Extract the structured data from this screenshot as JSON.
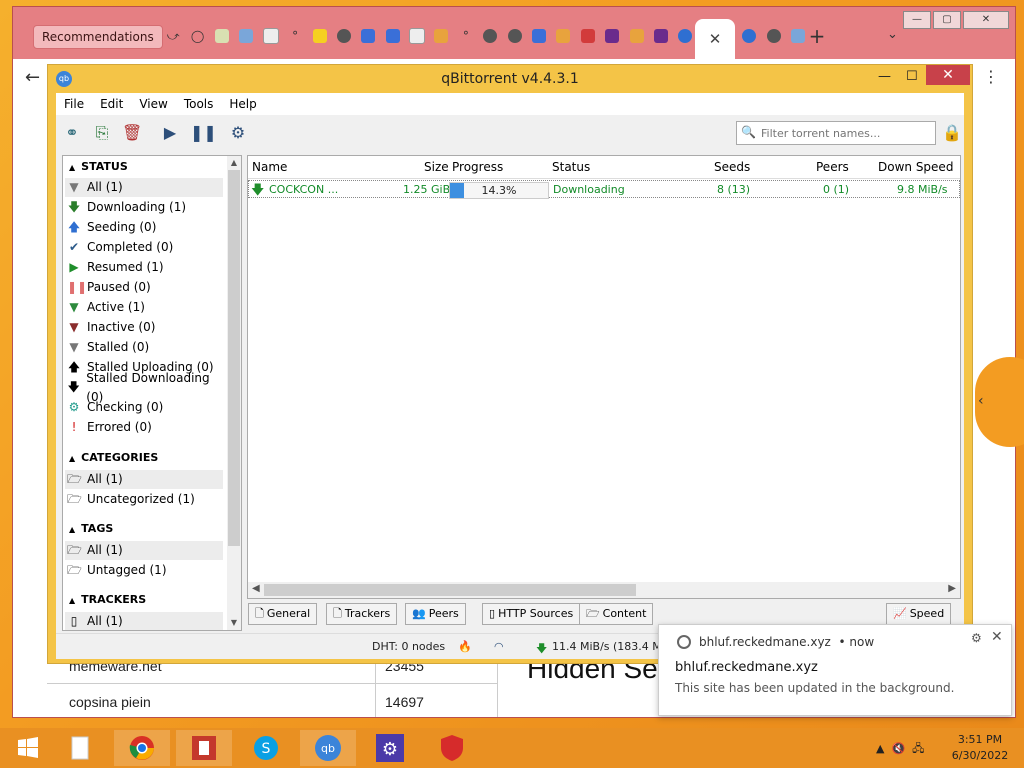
{
  "browser": {
    "recommendations_label": "Recommendations",
    "new_tab_label": "+",
    "active_tab_close": "✕",
    "tab_dropdown": "⌄",
    "back_arrow": "←",
    "menu_kebab": "⋮",
    "window_min": "—",
    "window_max": "▢",
    "window_close": "✕"
  },
  "webpage": {
    "rows": [
      {
        "name": "memeware.net",
        "value": "23455"
      },
      {
        "name": "copsina piein",
        "value": "14697"
      }
    ],
    "heading": "Hidden Se",
    "side_arrow": "‹"
  },
  "qbittorrent": {
    "title": "qBittorrent v4.4.3.1",
    "logo_text": "qb",
    "min": "—",
    "max": "☐",
    "close": "✕",
    "menu": [
      "File",
      "Edit",
      "View",
      "Tools",
      "Help"
    ],
    "search_placeholder": "Filter torrent names...",
    "sidebar": {
      "status_header": "STATUS",
      "status_items": [
        {
          "label": "All (1)",
          "icon": "filter-icon",
          "color": "#777777"
        },
        {
          "label": "Downloading (1)",
          "icon": "download-arrow-icon",
          "color": "#2a7d2a"
        },
        {
          "label": "Seeding (0)",
          "icon": "upload-arrow-icon",
          "color": "#2f6fd1"
        },
        {
          "label": "Completed (0)",
          "icon": "checkmark-icon",
          "color": "#2d5b8a"
        },
        {
          "label": "Resumed (1)",
          "icon": "play-icon",
          "color": "#1f8e2b"
        },
        {
          "label": "Paused (0)",
          "icon": "pause-icon",
          "color": "#e07070"
        },
        {
          "label": "Active (1)",
          "icon": "filter-icon",
          "color": "#2d8a3d"
        },
        {
          "label": "Inactive (0)",
          "icon": "filter-icon",
          "color": "#8a2d2d"
        },
        {
          "label": "Stalled (0)",
          "icon": "filter-icon",
          "color": "#777777"
        },
        {
          "label": "Stalled Uploading (0)",
          "icon": "upload-arrow-icon",
          "color": "#000000"
        },
        {
          "label": "Stalled Downloading (0)",
          "icon": "download-arrow-icon",
          "color": "#000000"
        },
        {
          "label": "Checking (0)",
          "icon": "gear-icon",
          "color": "#1e9a8a"
        },
        {
          "label": "Errored (0)",
          "icon": "exclamation-icon",
          "color": "#d11a1a"
        }
      ],
      "categories_header": "CATEGORIES",
      "category_items": [
        "All (1)",
        "Uncategorized (1)"
      ],
      "tags_header": "TAGS",
      "tag_items": [
        "All (1)",
        "Untagged (1)"
      ],
      "trackers_header": "TRACKERS",
      "tracker_items": [
        "All (1)"
      ]
    },
    "columns": {
      "name": "Name",
      "size": "Size",
      "progress": "Progress",
      "status": "Status",
      "seeds": "Seeds",
      "peers": "Peers",
      "down_speed": "Down Speed"
    },
    "torrents": [
      {
        "name": "COCKCON ...",
        "size": "1.25 GiB",
        "progress": 0.143,
        "progress_text": "14.3%",
        "status": "Downloading",
        "seeds": "8 (13)",
        "peers": "0 (1)",
        "down_speed": "9.8 MiB/s"
      }
    ],
    "bottom_tabs": [
      "General",
      "Trackers",
      "Peers",
      "HTTP Sources",
      "Content"
    ],
    "speed_tab": "Speed",
    "statusbar": {
      "dht": "DHT: 0 nodes",
      "download": "11.4 MiB/s (183.4 Mi"
    }
  },
  "notification": {
    "host": "bhluf.reckedmane.xyz",
    "time": "•  now",
    "title": "bhluf.reckedmane.xyz",
    "body": "This site has been updated in the background."
  },
  "taskbar": {
    "time": "3:51 PM",
    "date": "6/30/2022"
  }
}
